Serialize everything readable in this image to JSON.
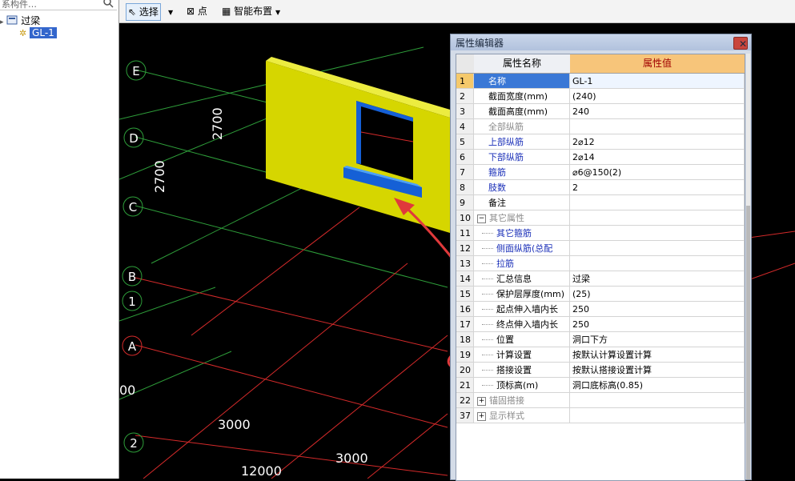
{
  "left_panel": {
    "search_placeholder": "系构件…",
    "tree": {
      "root_label": "过梁",
      "child_label": "GL-1"
    }
  },
  "toolbar": {
    "select_label": "选择",
    "point_label": "点",
    "smart_layout_label": "智能布置"
  },
  "canvas": {
    "axis_labels": [
      "E",
      "D",
      "C",
      "B",
      "1",
      "A",
      "2"
    ],
    "dimensions": [
      "2700",
      "2700",
      "3000",
      "3000",
      "12000",
      "00"
    ]
  },
  "property_editor": {
    "title": "属性编辑器",
    "columns": {
      "name": "属性名称",
      "value": "属性值"
    },
    "rows": [
      {
        "num": "1",
        "name": "名称",
        "value": "GL-1",
        "style": "blue",
        "indent": 1,
        "selected": true
      },
      {
        "num": "2",
        "name": "截面宽度(mm)",
        "value": "(240)",
        "style": "black",
        "indent": 1
      },
      {
        "num": "3",
        "name": "截面高度(mm)",
        "value": "240",
        "style": "black",
        "indent": 1
      },
      {
        "num": "4",
        "name": "全部纵筋",
        "value": "",
        "style": "gray",
        "indent": 1
      },
      {
        "num": "5",
        "name": "上部纵筋",
        "value": "2⌀12",
        "style": "blue",
        "indent": 1
      },
      {
        "num": "6",
        "name": "下部纵筋",
        "value": "2⌀14",
        "style": "blue",
        "indent": 1
      },
      {
        "num": "7",
        "name": "箍筋",
        "value": "⌀6@150(2)",
        "style": "blue",
        "indent": 1
      },
      {
        "num": "8",
        "name": "肢数",
        "value": "2",
        "style": "blue",
        "indent": 1
      },
      {
        "num": "9",
        "name": "备注",
        "value": "",
        "style": "black",
        "indent": 1
      },
      {
        "num": "10",
        "name": "其它属性",
        "value": "",
        "style": "gray",
        "expander": "−",
        "indent": 0
      },
      {
        "num": "11",
        "name": "其它箍筋",
        "value": "",
        "style": "blue",
        "indent": 2
      },
      {
        "num": "12",
        "name": "侧面纵筋(总配",
        "value": "",
        "style": "blue",
        "indent": 2
      },
      {
        "num": "13",
        "name": "拉筋",
        "value": "",
        "style": "blue",
        "indent": 2
      },
      {
        "num": "14",
        "name": "汇总信息",
        "value": "过梁",
        "style": "black",
        "indent": 2
      },
      {
        "num": "15",
        "name": "保护层厚度(mm)",
        "value": "(25)",
        "style": "black",
        "indent": 2
      },
      {
        "num": "16",
        "name": "起点伸入墙内长",
        "value": "250",
        "style": "black",
        "indent": 2
      },
      {
        "num": "17",
        "name": "终点伸入墙内长",
        "value": "250",
        "style": "black",
        "indent": 2
      },
      {
        "num": "18",
        "name": "位置",
        "value": "洞口下方",
        "style": "black",
        "indent": 2
      },
      {
        "num": "19",
        "name": "计算设置",
        "value": "按默认计算设置计算",
        "style": "black",
        "indent": 2
      },
      {
        "num": "20",
        "name": "搭接设置",
        "value": "按默认搭接设置计算",
        "style": "black",
        "indent": 2
      },
      {
        "num": "21",
        "name": "顶标高(m)",
        "value": "洞口底标高(0.85)",
        "style": "black",
        "indent": 2
      },
      {
        "num": "22",
        "name": "锚固搭接",
        "value": "",
        "style": "gray",
        "expander": "+",
        "indent": 0
      },
      {
        "num": "37",
        "name": "显示样式",
        "value": "",
        "style": "gray",
        "expander": "+",
        "indent": 0
      }
    ]
  },
  "colors": {
    "grid_green": "#2e9e3a",
    "grid_red": "#d42a2a",
    "wall_yellow": "#d6d600",
    "lintel_blue": "#1560d6",
    "annotation_red": "#e0393b"
  }
}
